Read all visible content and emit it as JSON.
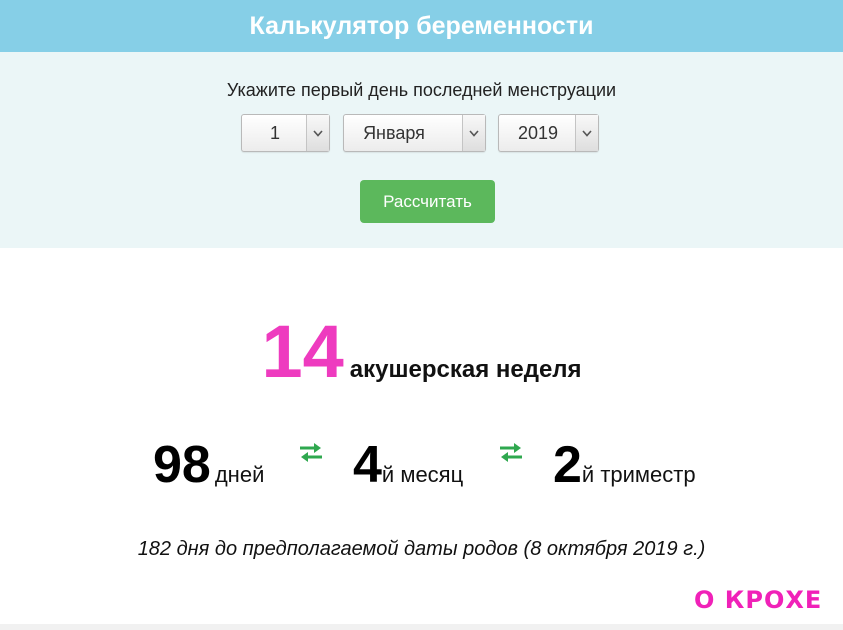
{
  "header": {
    "title": "Калькулятор беременности"
  },
  "form": {
    "prompt": "Укажите первый день последней менструации",
    "day_select": {
      "value": "1"
    },
    "month_select": {
      "value": "Января"
    },
    "year_select": {
      "value": "2019"
    },
    "calculate_label": "Рассчитать"
  },
  "result": {
    "week_number": "14",
    "week_label": "акушерская неделя",
    "days": {
      "value": "98",
      "label": "дней"
    },
    "month": {
      "value": "4",
      "label": "й месяц"
    },
    "trimester": {
      "value": "2",
      "label": "й триместр"
    },
    "due_text": "182 дня до предполагаемой даты родов (8 октября 2019 г.)"
  },
  "brand": {
    "logo_text": "О КРОХЕ"
  },
  "icons": {
    "select_arrow": "chevron-down-icon",
    "swap": "swap-arrows-icon"
  },
  "colors": {
    "header_bg": "#86cfe7",
    "panel_bg": "#ebf6f7",
    "button_bg": "#5cb85c",
    "accent_pink": "#ee3bbf",
    "swap_green": "#2fa84f"
  }
}
